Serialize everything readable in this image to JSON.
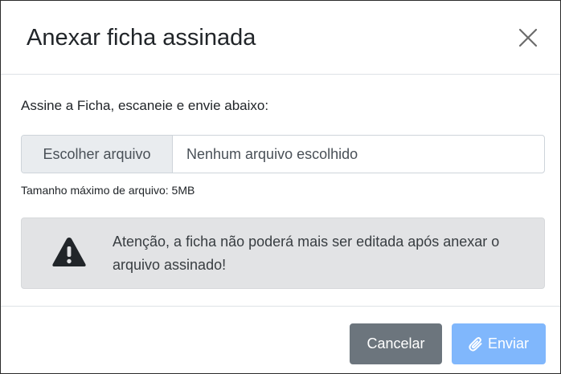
{
  "dialog": {
    "title": "Anexar ficha assinada",
    "close_icon": "close-icon"
  },
  "body": {
    "instruction": "Assine a Ficha, escaneie e envie abaixo:",
    "file_input": {
      "button_label": "Escolher arquivo",
      "value": "Nenhum arquivo escolhido"
    },
    "max_size_text": "Tamanho máximo de arquivo: 5MB",
    "alert": {
      "icon": "warning-icon",
      "text": "Atenção, a ficha não poderá mais ser editada após anexar o arquivo assinado!"
    }
  },
  "footer": {
    "cancel_label": "Cancelar",
    "send_label": "Enviar",
    "send_icon": "paperclip-icon"
  },
  "colors": {
    "cancel_button": "#6c757d",
    "send_button": "#80b7fc",
    "alert_background": "#e2e3e5",
    "file_button_background": "#e9ecef"
  }
}
